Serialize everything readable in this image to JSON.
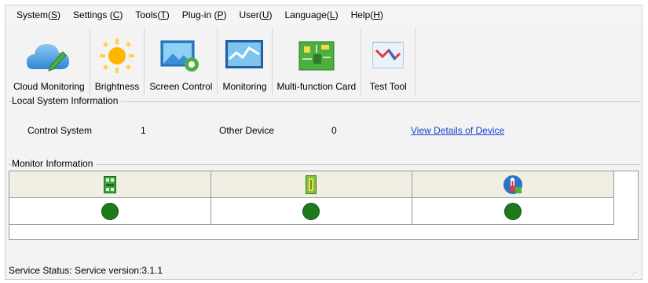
{
  "menu": [
    {
      "label": "System(",
      "key": "S",
      "tail": ")"
    },
    {
      "label": "Settings (",
      "key": "C",
      "tail": ")"
    },
    {
      "label": "Tools(",
      "key": "T",
      "tail": ")"
    },
    {
      "label": "Plug-in (",
      "key": "P",
      "tail": ")"
    },
    {
      "label": "User(",
      "key": "U",
      "tail": ")"
    },
    {
      "label": "Language(",
      "key": "L",
      "tail": ")"
    },
    {
      "label": "Help(",
      "key": "H",
      "tail": ")"
    }
  ],
  "toolbar": {
    "cloud_monitoring": "Cloud Monitoring",
    "brightness": "Brightness",
    "screen_control": "Screen Control",
    "monitoring": "Monitoring",
    "multifunction_card": "Multi-function Card",
    "test_tool": "Test Tool"
  },
  "local_system": {
    "title": "Local System Information",
    "control_system_label": "Control System",
    "control_system_count": "1",
    "other_device_label": "Other Device",
    "other_device_count": "0",
    "details_link": "View Details of Device"
  },
  "monitor": {
    "title": "Monitor Information",
    "columns": [
      "receiving-card-icon",
      "multifunction-card-icon",
      "temperature-icon"
    ],
    "status_color": "#1f7a1c"
  },
  "status_bar": {
    "text": "Service Status:  Service version:3.1.1"
  }
}
